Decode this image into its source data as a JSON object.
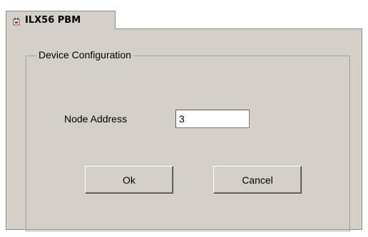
{
  "tab": {
    "icon": "module-icon",
    "label": "ILX56 PBM"
  },
  "group": {
    "title": "Device Configuration"
  },
  "node_address": {
    "label": "Node Address",
    "value": "3"
  },
  "buttons": {
    "ok_label": "Ok",
    "cancel_label": "Cancel"
  },
  "colors": {
    "panel_background": "#d4d0c8",
    "icon_accent": "#c0392b"
  }
}
